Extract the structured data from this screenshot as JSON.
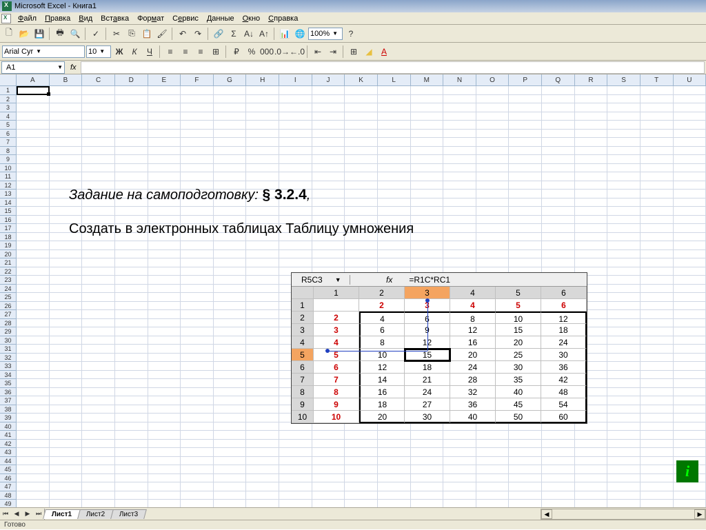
{
  "title": "Microsoft Excel - Книга1",
  "menu": [
    "Файл",
    "Правка",
    "Вид",
    "Вставка",
    "Формат",
    "Сервис",
    "Данные",
    "Окно",
    "Справка"
  ],
  "zoom": "100%",
  "font_name": "Arial Cyr",
  "font_size": "10",
  "name_box": "A1",
  "columns": [
    "A",
    "B",
    "C",
    "D",
    "E",
    "F",
    "G",
    "H",
    "I",
    "J",
    "K",
    "L",
    "M",
    "N",
    "O",
    "P",
    "Q",
    "R",
    "S",
    "T",
    "U"
  ],
  "row_count": 50,
  "overlay": {
    "line1_prefix": "Задание на самоподготовку: ",
    "line1_bold": "§ 3.2.4",
    "line1_suffix": ",",
    "line2": "Создать в электронных таблицах Таблицу умножения"
  },
  "mult": {
    "name_box": "R5C3",
    "fx": "fx",
    "formula": "=R1C*RC1",
    "col_headers": [
      "1",
      "2",
      "3",
      "4",
      "5",
      "6"
    ],
    "row_headers": [
      "1",
      "2",
      "3",
      "4",
      "5",
      "6",
      "7",
      "8",
      "9",
      "10"
    ],
    "cells": [
      [
        "",
        "2",
        "3",
        "4",
        "5",
        "6"
      ],
      [
        "2",
        "4",
        "6",
        "8",
        "10",
        "12"
      ],
      [
        "3",
        "6",
        "9",
        "12",
        "15",
        "18"
      ],
      [
        "4",
        "8",
        "12",
        "16",
        "20",
        "24"
      ],
      [
        "5",
        "10",
        "15",
        "20",
        "25",
        "30"
      ],
      [
        "6",
        "12",
        "18",
        "24",
        "30",
        "36"
      ],
      [
        "7",
        "14",
        "21",
        "28",
        "35",
        "42"
      ],
      [
        "8",
        "16",
        "24",
        "32",
        "40",
        "48"
      ],
      [
        "9",
        "18",
        "27",
        "36",
        "45",
        "54"
      ],
      [
        "10",
        "20",
        "30",
        "40",
        "50",
        "60"
      ]
    ]
  },
  "sheets": [
    "Лист1",
    "Лист2",
    "Лист3"
  ],
  "status": "Готово"
}
